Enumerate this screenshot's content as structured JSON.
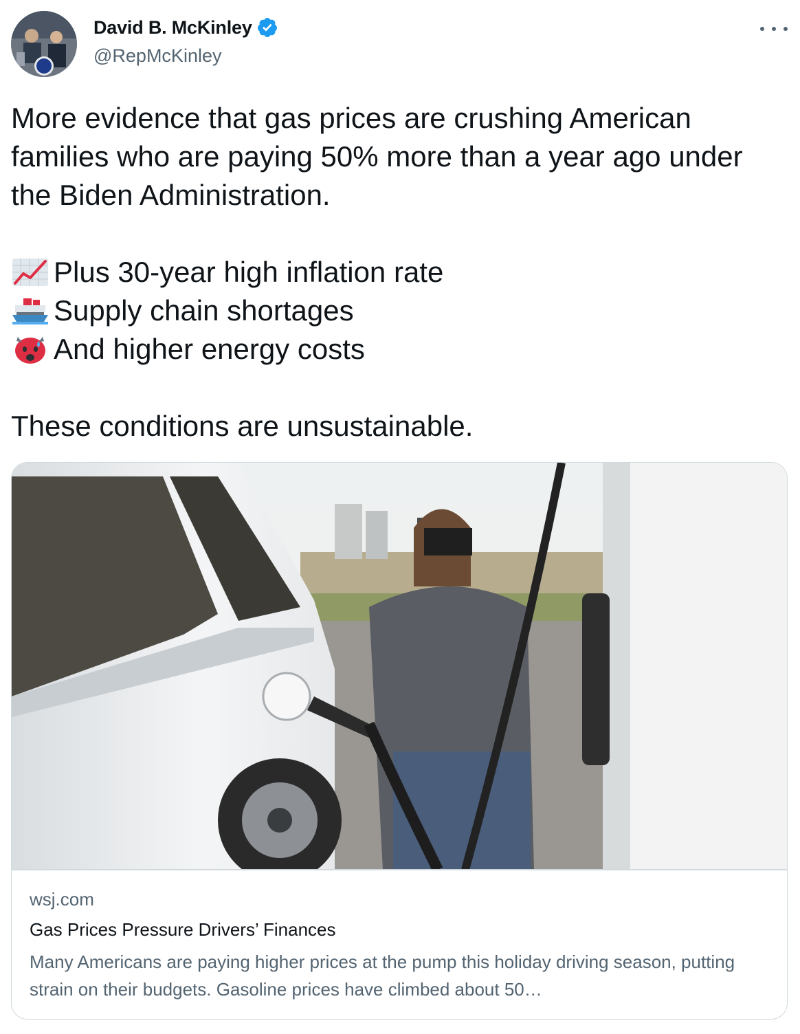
{
  "author": {
    "name": "David B. McKinley",
    "handle": "@RepMcKinley",
    "verified": true
  },
  "tweet": {
    "intro": "More evidence that gas prices are crushing American families who are paying 50% more than a year ago under the Biden Administration.",
    "bullets": [
      {
        "icon": "chart-increasing-icon",
        "text": "Plus 30-year high inflation rate"
      },
      {
        "icon": "ship-icon",
        "text": "Supply chain shortages"
      },
      {
        "icon": "hot-face-icon",
        "text": "And higher energy costs"
      }
    ],
    "closing": "These conditions are unsustainable."
  },
  "card": {
    "domain": "wsj.com",
    "title": "Gas Prices Pressure Drivers’ Finances",
    "description": "Many Americans are paying higher prices at the pump this holiday driving season, putting strain on their budgets. Gasoline prices have climbed about 50…"
  },
  "colors": {
    "text": "#0f1419",
    "secondary": "#536471",
    "verified": "#1d9bf0",
    "border": "#cfd9de"
  }
}
